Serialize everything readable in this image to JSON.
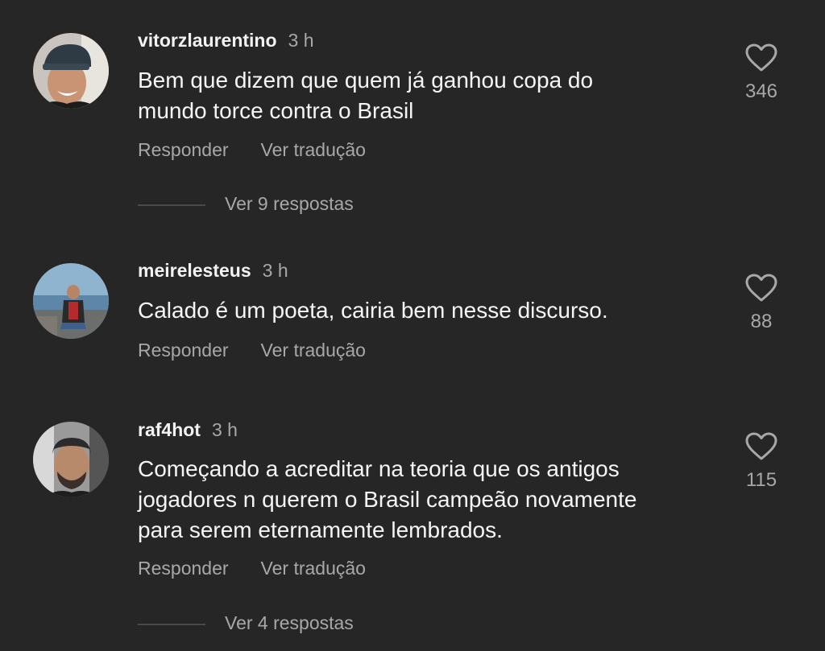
{
  "colors": {
    "background": "#262626",
    "primary_text": "#f5f5f5",
    "secondary_text": "#a8a8a8"
  },
  "comments": [
    {
      "username": "vitorzlaurentino",
      "time": "3 h",
      "text_lines": [
        "Bem que dizem que quem já ganhou copa do",
        "mundo torce contra o Brasil"
      ],
      "reply_label": "Responder",
      "translate_label": "Ver tradução",
      "like_icon": "heart-outline-icon",
      "likes": "346",
      "view_replies": "Ver 9 respostas"
    },
    {
      "username": "meirelesteus",
      "time": "3 h",
      "text_lines": [
        "Calado é um poeta, cairia bem nesse discurso."
      ],
      "reply_label": "Responder",
      "translate_label": "Ver tradução",
      "like_icon": "heart-outline-icon",
      "likes": "88"
    },
    {
      "username": "raf4hot",
      "time": "3 h",
      "text_lines": [
        "Começando a acreditar na teoria que os antigos",
        "jogadores n querem o Brasil campeão novamente",
        "para serem eternamente lembrados."
      ],
      "reply_label": "Responder",
      "translate_label": "Ver tradução",
      "like_icon": "heart-outline-icon",
      "likes": "115",
      "view_replies": "Ver 4 respostas"
    }
  ]
}
